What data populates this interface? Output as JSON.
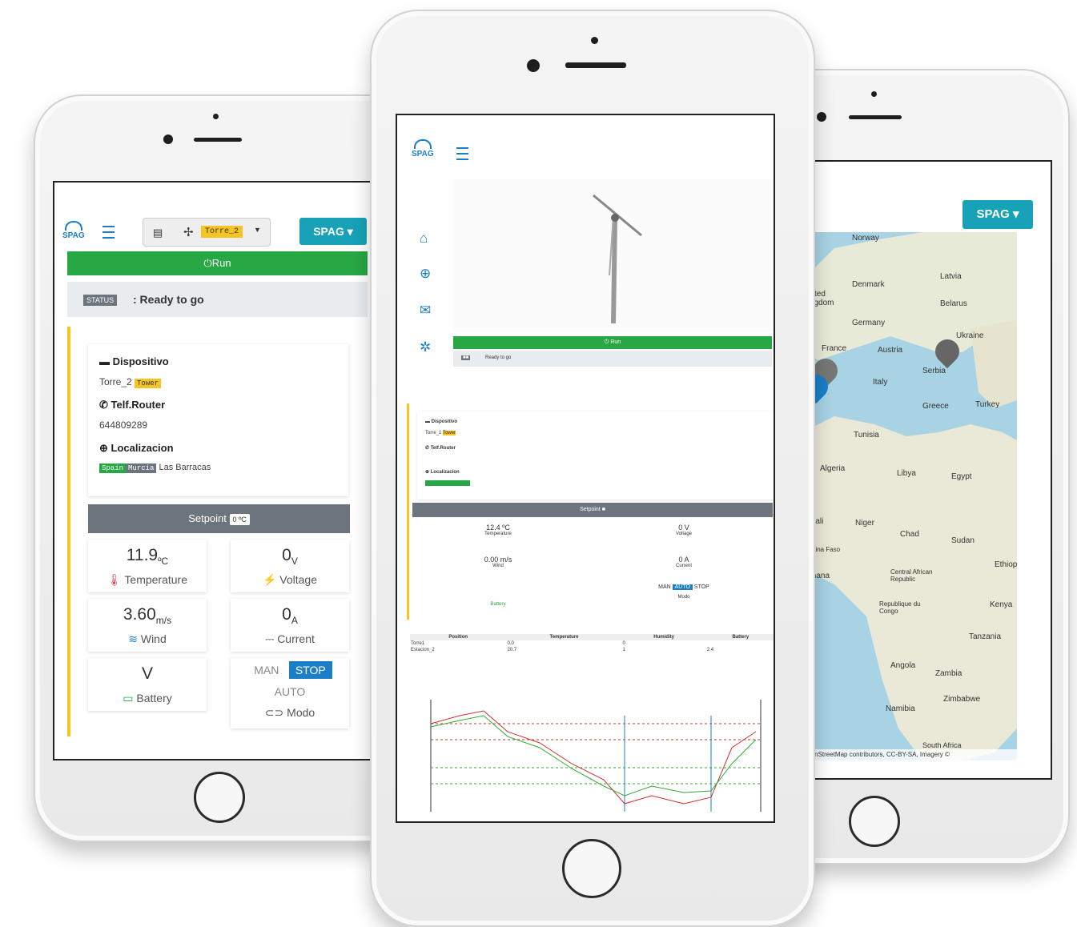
{
  "left": {
    "brand": "SPAG",
    "tower_badge": "Torre_2",
    "dropdown_label": "SPAG",
    "run_label": "Run",
    "status_badge": "STATUS",
    "status_text": ": Ready to go",
    "device_label": "Dispositivo",
    "device_name": "Torre_2",
    "device_tag": "Tower",
    "router_label": "Telf.Router",
    "router_value": "644809289",
    "location_label": "Localizacion",
    "location_country": "Spain",
    "location_region": "Murcia",
    "location_place": "Las Barracas",
    "setpoint_label": "Setpoint",
    "setpoint_value": "0 ºC",
    "tiles": {
      "temperature": {
        "value": "11.9",
        "unit": "ºC",
        "label": "Temperature"
      },
      "voltage": {
        "value": "0",
        "unit": "V",
        "label": "Voltage"
      },
      "wind": {
        "value": "3.60",
        "unit": "m/s",
        "label": "Wind"
      },
      "current": {
        "value": "0",
        "unit": "A",
        "label": "Current"
      },
      "battery": {
        "value": "V",
        "label": "Battery"
      },
      "mode": {
        "man": "MAN",
        "stop": "STOP",
        "auto": "AUTO",
        "label": "Modo"
      }
    },
    "colors": {
      "run": "#28a745",
      "accent": "#17a2b8",
      "warning": "#f6c524"
    }
  },
  "right": {
    "dropdown_label": "SPAG",
    "map_labels": [
      "Norway",
      "Denmark",
      "Latvia",
      "United Kingdom",
      "Belarus",
      "Germany",
      "Ukraine",
      "France",
      "Austria",
      "Serbia",
      "Italy",
      "Greece",
      "Turkey",
      "Tunisia",
      "Algeria",
      "Libya",
      "Egypt",
      "Mali",
      "Niger",
      "Chad",
      "Sudan",
      "Burkina Faso",
      "Ghana",
      "Central African Republic",
      "Ethiopia",
      "Republique du Congo",
      "Kenya",
      "Tanzania",
      "Angola",
      "Zambia",
      "Namibia",
      "Zimbabwe",
      "South Africa"
    ],
    "attribution": "OpenStreetMap contributors, CC-BY-SA, Imagery ©"
  },
  "center": {
    "brand": "SPAG",
    "nav_icons": [
      "home-icon",
      "globe-icon",
      "mail-icon",
      "gear-icon"
    ],
    "run_label": "Run",
    "status_text": "Ready to go",
    "device_label": "Dispositivo",
    "device_name": "Torre_1",
    "device_tag": "Tower",
    "router_label": "Telf.Router",
    "location_label": "Localizacion",
    "setpoint_label": "Setpoint",
    "grid_values": [
      "12.4 ºC",
      "0 V",
      "0.00 m/s",
      "0 A"
    ],
    "grid_labels": [
      "Temperature",
      "Voltage",
      "Wind",
      "Current",
      "Battery",
      "Modo"
    ],
    "mode": {
      "man": "MAN",
      "auto": "AUTO",
      "stop": "STOP"
    },
    "table_headers": [
      "Position",
      "Temperature",
      "Humidity",
      "Battery"
    ],
    "table_rows": [
      [
        "Torre1",
        "0.0",
        "0",
        ""
      ],
      [
        "Estacion_2",
        "20.7",
        "1",
        "2.4"
      ]
    ]
  }
}
